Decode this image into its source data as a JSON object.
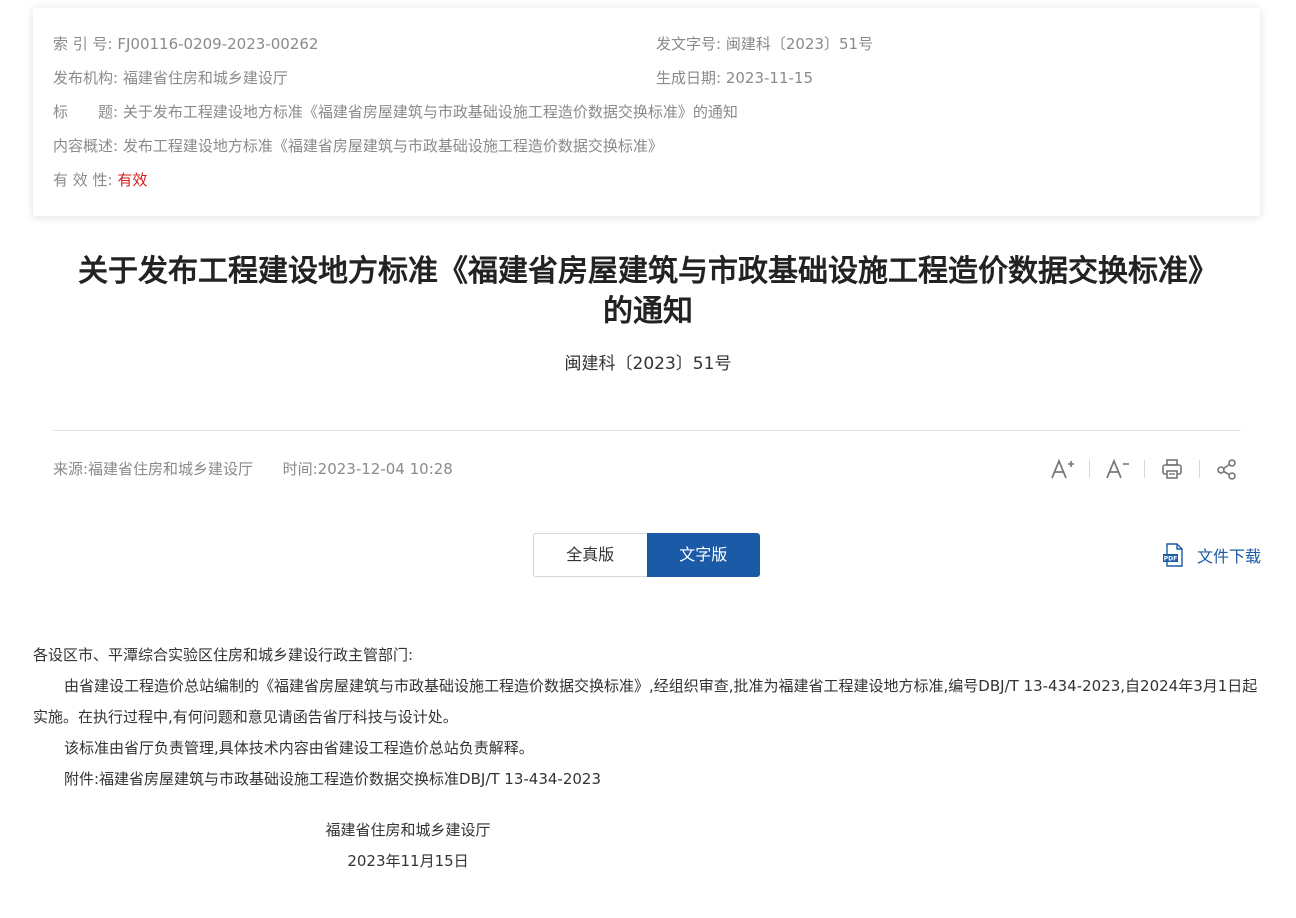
{
  "meta": {
    "index_label": "索 引 号:",
    "index_value": "FJ00116-0209-2023-00262",
    "doc_no_label": "发文字号:",
    "doc_no_value": "闽建科〔2023〕51号",
    "issuer_label": "发布机构:",
    "issuer_value": "福建省住房和城乡建设厅",
    "date_label": "生成日期:",
    "date_value": "2023-11-15",
    "title_label": "标　　题:",
    "title_value": "关于发布工程建设地方标准《福建省房屋建筑与市政基础设施工程造价数据交换标准》的通知",
    "summary_label": "内容概述:",
    "summary_value": "发布工程建设地方标准《福建省房屋建筑与市政基础设施工程造价数据交换标准》",
    "validity_label": "有 效 性:",
    "validity_value": "有效"
  },
  "article": {
    "title_line1": "关于发布工程建设地方标准《福建省房屋建筑与市政基础设施工程造价数据交换标准》",
    "title_line2": "的通知",
    "doc_number": "闽建科〔2023〕51号",
    "source": "来源:福建省住房和城乡建设厅",
    "time": "时间:2023-12-04 10:28"
  },
  "tools": {
    "font_increase": "A+",
    "font_decrease": "A-",
    "print": "print",
    "share": "share"
  },
  "toggle": {
    "full_label": "全真版",
    "text_label": "文字版"
  },
  "download": {
    "label": "文件下载",
    "icon_text": "PDF"
  },
  "body": {
    "salutation": "各设区市、平潭综合实验区住房和城乡建设行政主管部门:",
    "para1": "由省建设工程造价总站编制的《福建省房屋建筑与市政基础设施工程造价数据交换标准》,经组织审查,批准为福建省工程建设地方标准,编号DBJ/T 13-434-2023,自2024年3月1日起实施。在执行过程中,有何问题和意见请函告省厅科技与设计处。",
    "para2": "该标准由省厅负责管理,具体技术内容由省建设工程造价总站负责解释。",
    "para3": "附件:福建省房屋建筑与市政基础设施工程造价数据交换标准DBJ/T 13-434-2023",
    "sign_org": "福建省住房和城乡建设厅",
    "sign_date": "2023年11月15日"
  },
  "colors": {
    "accent": "#1b5aa6",
    "valid": "#d61b1b",
    "muted": "#8a8a8a"
  }
}
